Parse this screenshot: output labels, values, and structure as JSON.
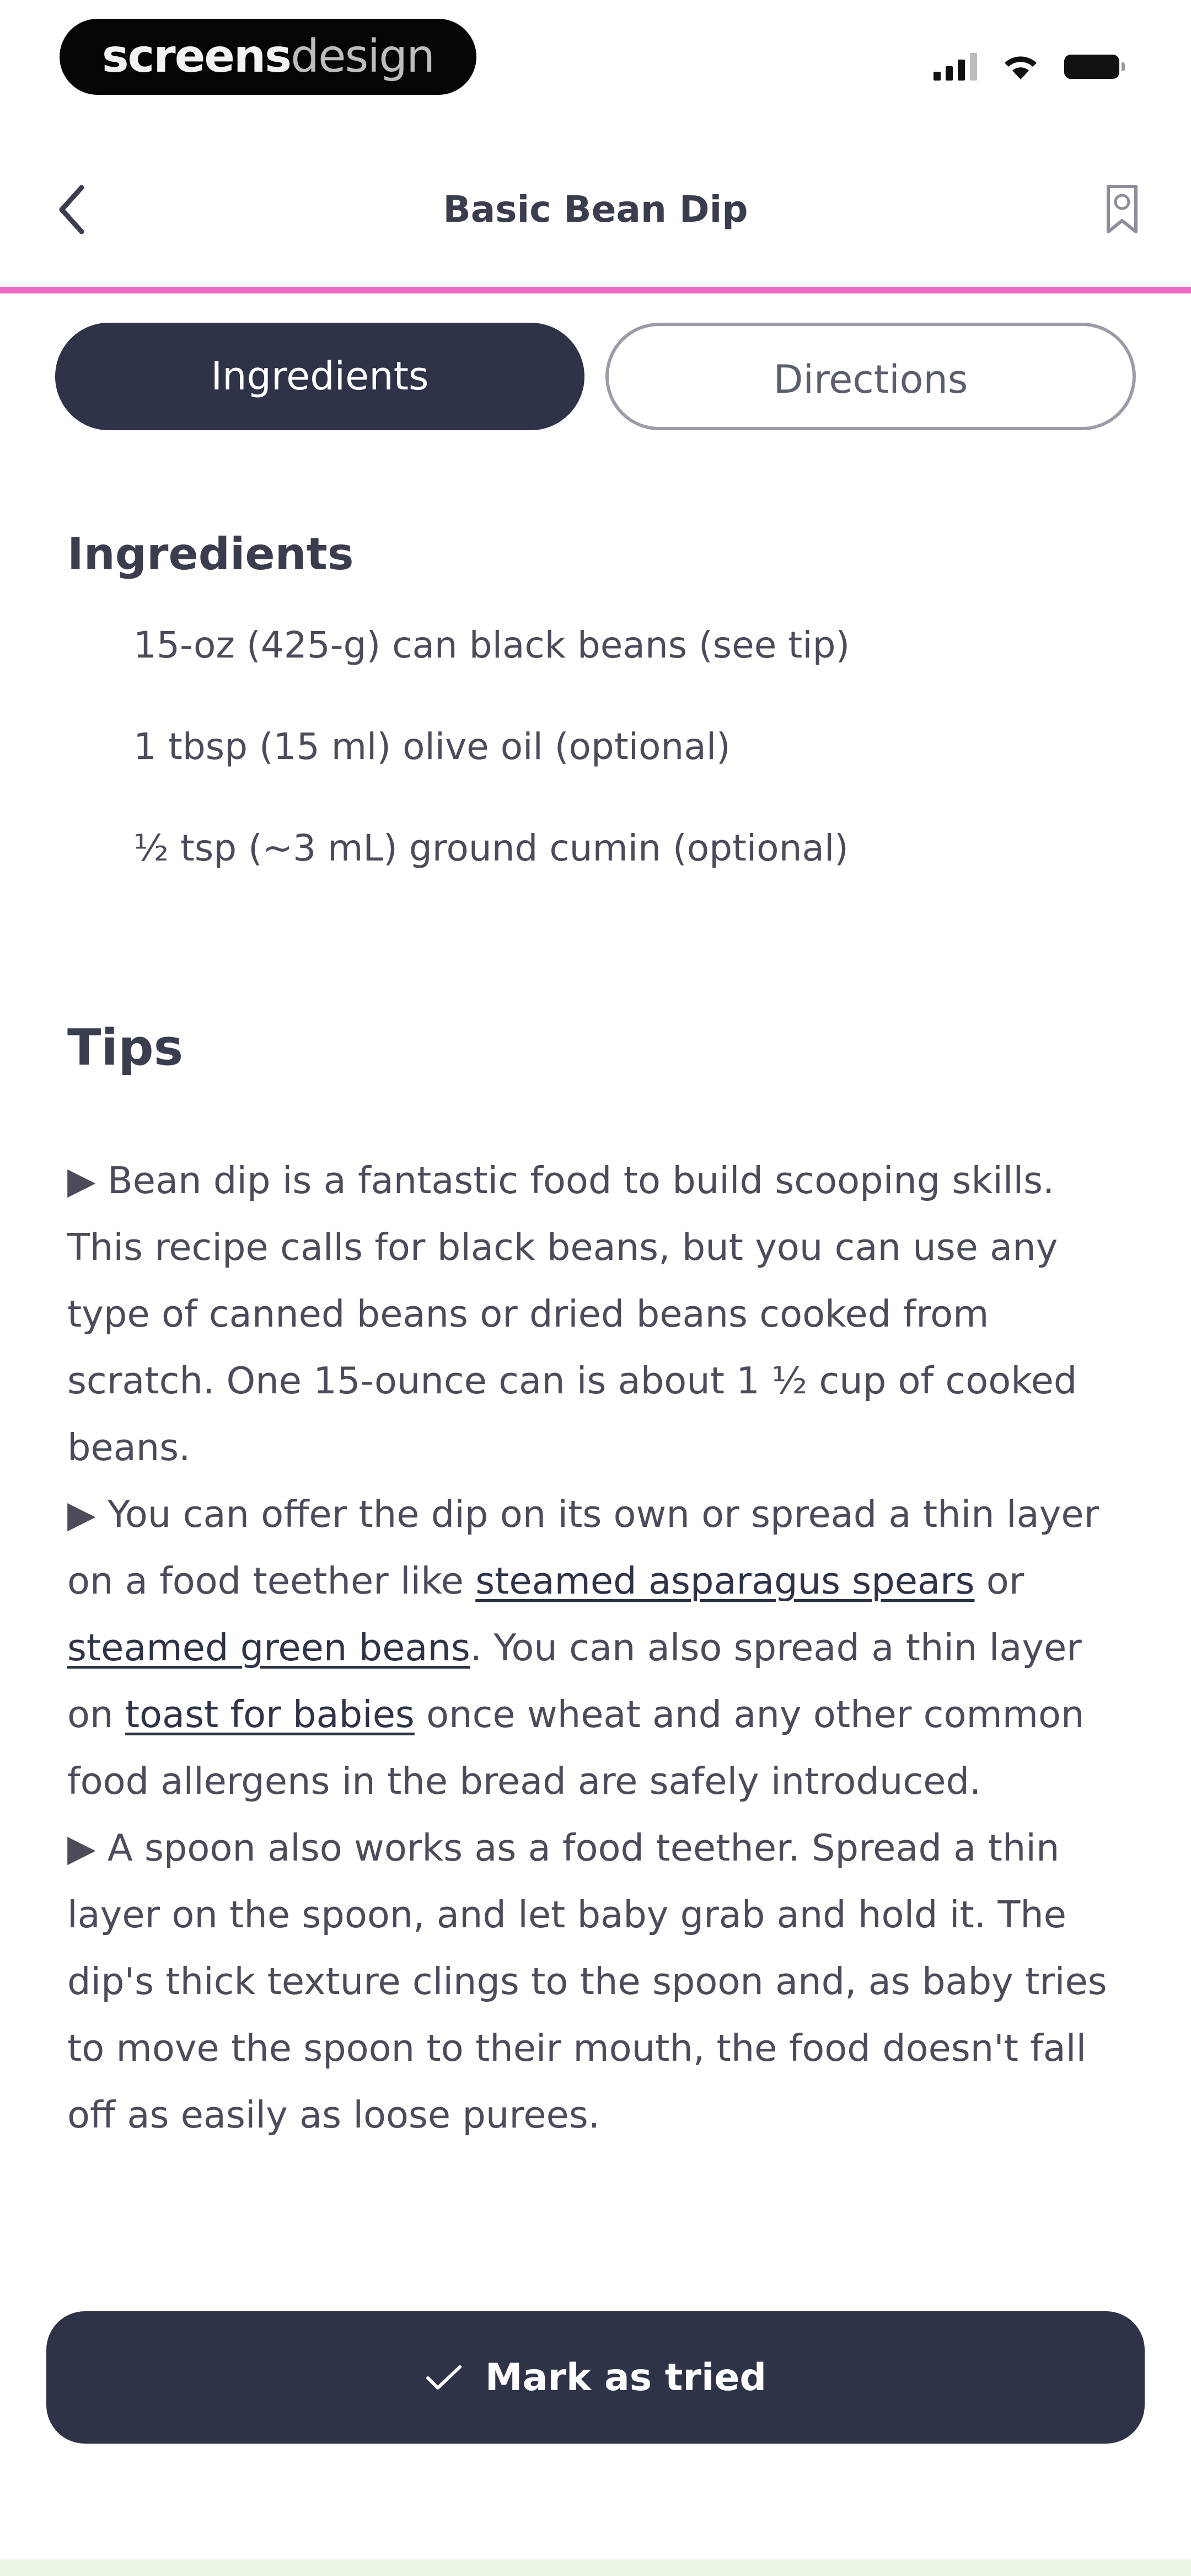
{
  "status_bar": {
    "watermark_bold": "screens",
    "watermark_light": "design",
    "icons": [
      "signal-icon",
      "wifi-icon",
      "battery-icon"
    ]
  },
  "nav": {
    "title": "Basic Bean Dip",
    "back_icon": "chevron-left-icon",
    "favorite_icon": "bookmark-icon"
  },
  "tabs": [
    {
      "label": "Ingredients",
      "selected": true
    },
    {
      "label": "Directions",
      "selected": false
    }
  ],
  "ingredients": {
    "heading": "Ingredients",
    "items": [
      "15-oz (425-g) can black beans (see tip)",
      "1 tbsp (15 ml) olive oil (optional)",
      "½ tsp (~3 mL) ground cumin (optional)"
    ]
  },
  "tips": {
    "heading": "Tips",
    "bullet": "▶",
    "tip1": "Bean dip is a fantastic food to build scooping skills. This recipe calls for black beans, but you can use any type of canned beans or dried beans cooked from scratch. One 15-ounce can is about 1 ½ cup of cooked beans.",
    "tip2_part1": "You can offer the dip on its own or spread a thin layer on a food teether like ",
    "tip2_link1": "steamed asparagus spears",
    "tip2_part2": " or ",
    "tip2_link2": "steamed green beans",
    "tip2_part3": ". You can also spread a thin layer on ",
    "tip2_link3": "toast for babies",
    "tip2_part4": " once wheat and any other common food allergens in the bread are safely introduced.",
    "tip3": "A spoon also works as a food teether. Spread a thin layer on the spoon, and let baby grab and hold it. The dip's thick texture clings to the spoon and, as baby tries to move the spoon to their mouth, the food doesn't fall off as easily as loose purees."
  },
  "action": {
    "label": "Mark as tried",
    "icon": "checkmark-icon"
  },
  "colors": {
    "primary": "#2f3348",
    "accent": "#ee68c6",
    "text": "#4a4c59"
  }
}
